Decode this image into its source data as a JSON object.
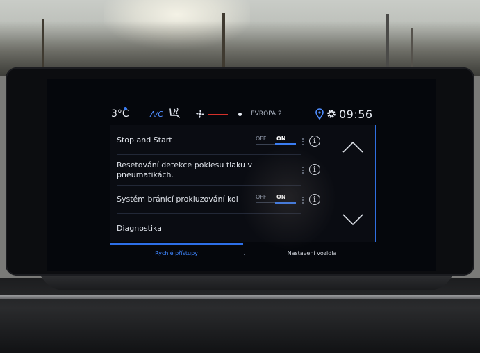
{
  "status_bar": {
    "temperature": "3°C",
    "ac_label": "A/C",
    "radio_station": "EVROPA 2",
    "time": "09:56",
    "icons": [
      "seat-heating-icon",
      "fan-icon",
      "location-icon",
      "settings-gear-icon"
    ],
    "fan_speed_fraction": 0.65
  },
  "left_buttons": [
    "music-icon",
    "navigation-icon",
    "climate-icon"
  ],
  "right_buttons": [
    "phone-icon",
    "apps-grid-icon",
    "car-icon"
  ],
  "settings": [
    {
      "label": "Stop and Start",
      "toggle": {
        "off": "OFF",
        "on": "ON",
        "state": "on"
      }
    },
    {
      "label": "Resetování detekce poklesu tlaku v pneumatikách.",
      "line1": "Resetování detekce poklesu tlaku v",
      "line2": "pneumatikách."
    },
    {
      "label": "Systém bránící prokluzování kol",
      "toggle": {
        "off": "OFF",
        "on": "ON",
        "state": "on"
      }
    },
    {
      "label": "Diagnostika"
    }
  ],
  "tabs": [
    {
      "label": "Rychlé přístupy",
      "active": true
    },
    {
      "label": "Nastavení vozidla",
      "active": false
    }
  ],
  "colors": {
    "accent": "#2d6fe8",
    "screen_bg": "#05070c",
    "text": "#dfe3ea"
  }
}
